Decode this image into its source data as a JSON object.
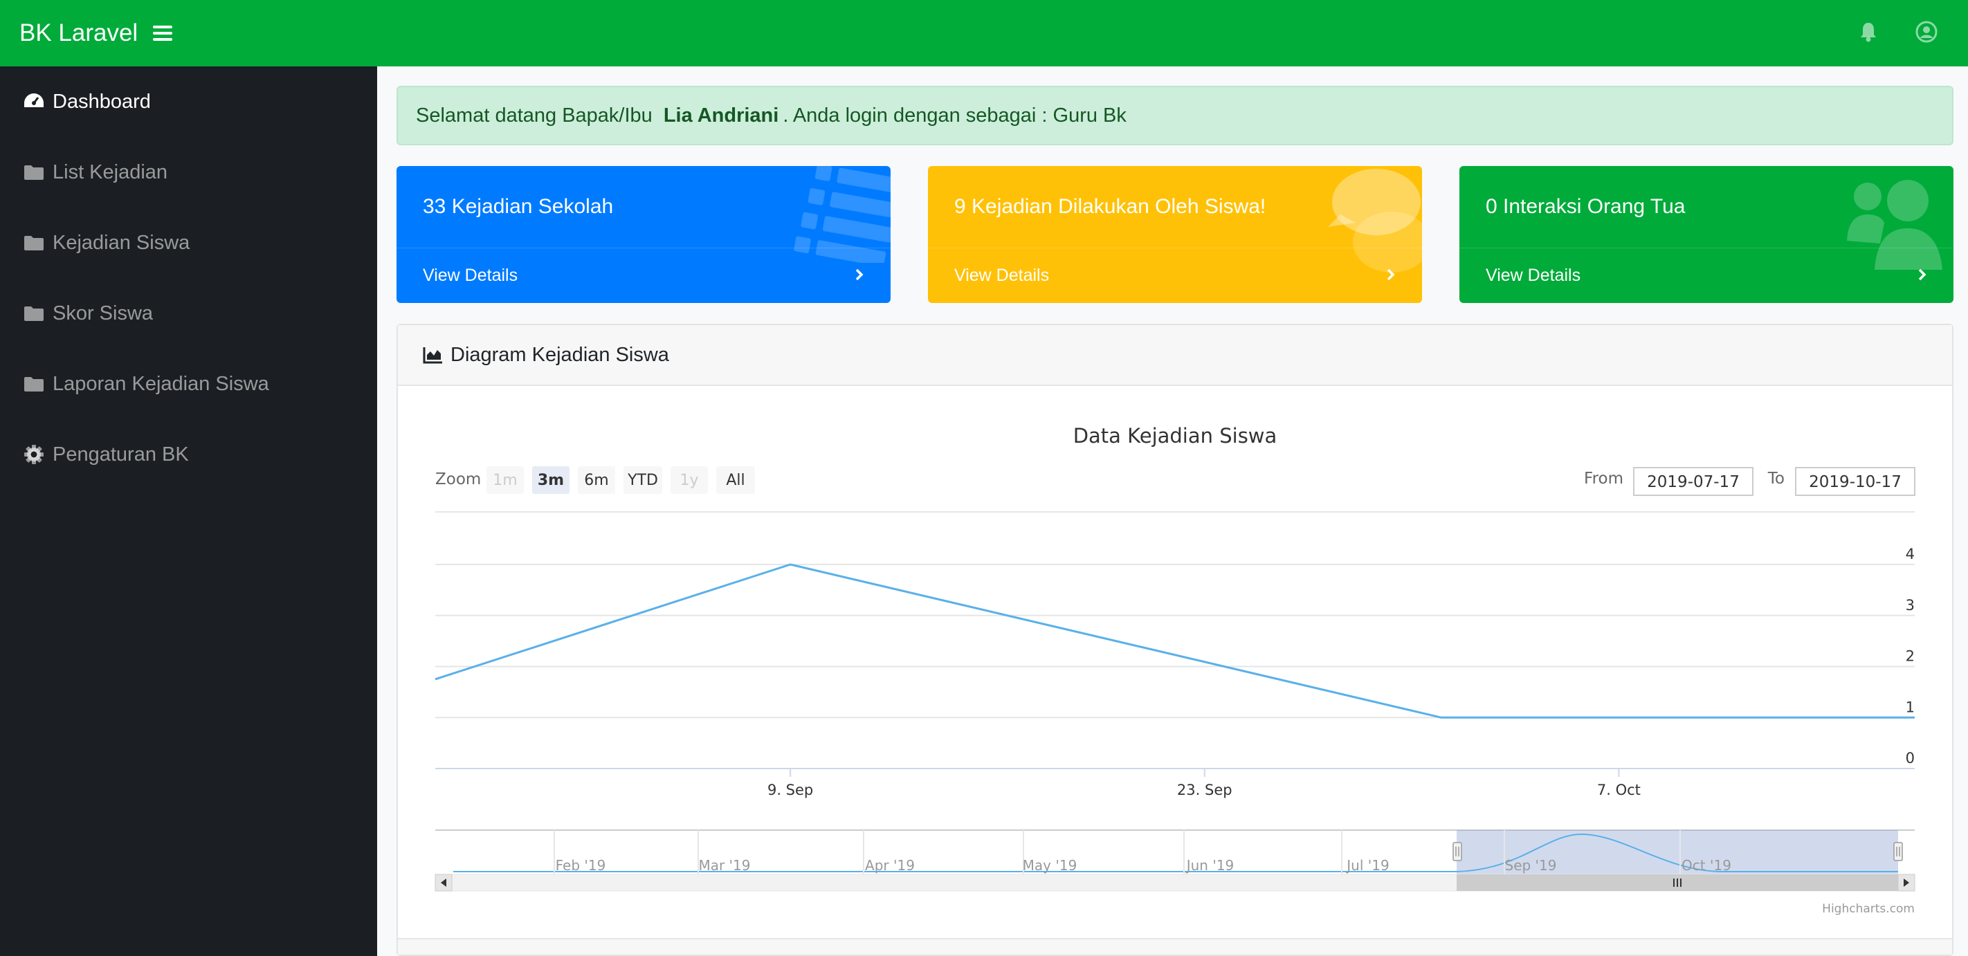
{
  "navbar": {
    "brand": "BK Laravel",
    "menu_icon": "hamburger-icon",
    "bell_icon": "bell-icon",
    "user_icon": "user-circle-icon",
    "color": "#00ab3a"
  },
  "sidebar": {
    "items": [
      {
        "label": "Dashboard",
        "icon": "tachometer-icon",
        "active": true
      },
      {
        "label": "List Kejadian",
        "icon": "folder-icon"
      },
      {
        "label": "Kejadian Siswa",
        "icon": "folder-icon"
      },
      {
        "label": "Skor Siswa",
        "icon": "folder-icon"
      },
      {
        "label": "Laporan Kejadian Siswa",
        "icon": "folder-icon"
      },
      {
        "label": "Pengaturan BK",
        "icon": "gear-icon"
      }
    ]
  },
  "alert": {
    "prefix": "Selamat datang Bapak/Ibu",
    "name": "Lia Andriani",
    "suffix": ". Anda login dengan sebagai : Guru Bk"
  },
  "cards": [
    {
      "title": "33 Kejadian Sekolah",
      "link": "View Details",
      "color": "#007bff",
      "icon": "list-icon"
    },
    {
      "title": "9 Kejadian Dilakukan Oleh Siswa!",
      "link": "View Details",
      "color": "#ffc107",
      "icon": "comments-icon"
    },
    {
      "title": "0 Interaksi Orang Tua",
      "link": "View Details",
      "color": "#00ab3a",
      "icon": "users-icon"
    }
  ],
  "panel": {
    "title": "Diagram Kejadian Siswa",
    "icon": "area-chart-icon"
  },
  "chart_data": {
    "type": "line",
    "title": "Data Kejadian Siswa",
    "zoom_label": "Zoom",
    "zoom_buttons": [
      {
        "label": "1m",
        "state": "disabled"
      },
      {
        "label": "3m",
        "state": "selected"
      },
      {
        "label": "6m",
        "state": "normal"
      },
      {
        "label": "YTD",
        "state": "normal"
      },
      {
        "label": "1y",
        "state": "disabled"
      },
      {
        "label": "All",
        "state": "normal"
      }
    ],
    "range": {
      "from_label": "From",
      "from": "2019-07-17",
      "to_label": "To",
      "to": "2019-10-17"
    },
    "x": [
      "2019-08-28",
      "2019-09-09",
      "2019-10-01",
      "2019-10-17"
    ],
    "y": [
      1.75,
      4,
      1,
      1
    ],
    "x_ticks": [
      "9. Sep",
      "23. Sep",
      "7. Oct"
    ],
    "y_ticks": [
      "0",
      "1",
      "2",
      "3",
      "4"
    ],
    "ylim": [
      0,
      4
    ],
    "color": "#5ab0e8",
    "navigator_ticks": [
      "Feb '19",
      "Mar '19",
      "Apr '19",
      "May '19",
      "Jun '19",
      "Jul '19",
      "Sep '19",
      "Oct '19"
    ],
    "credits": "Highcharts.com"
  }
}
